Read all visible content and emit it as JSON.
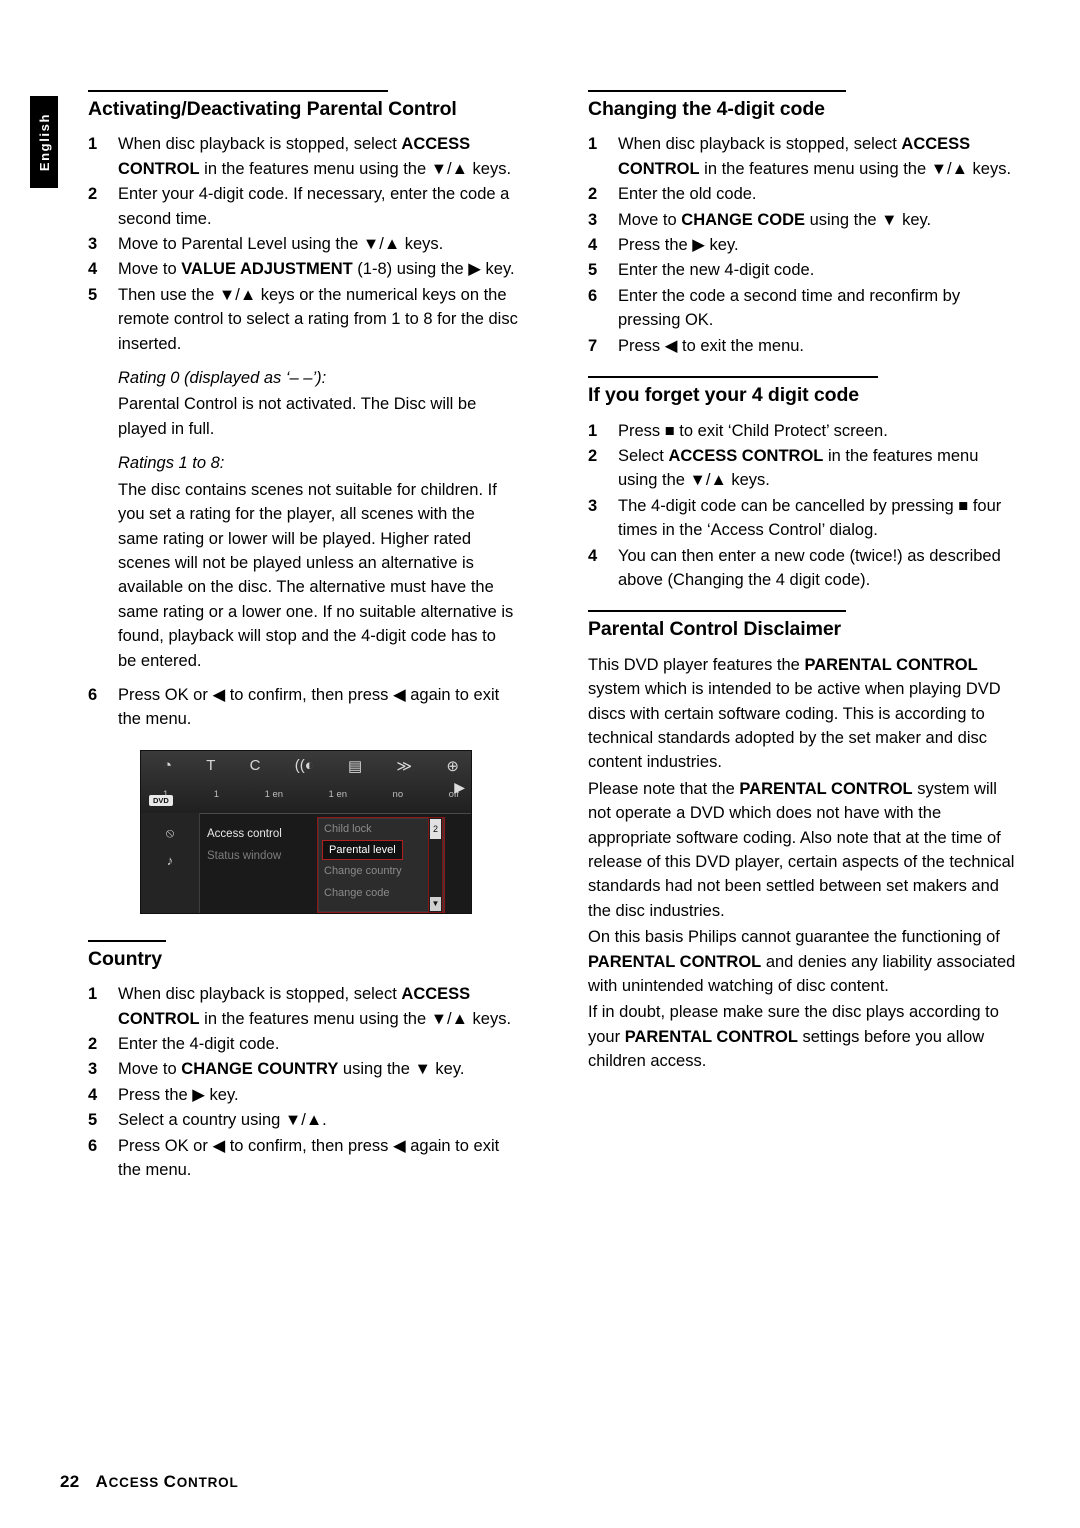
{
  "page": {
    "language_tab": "English",
    "footer_page": "22",
    "footer_title_a": "A",
    "footer_title_b": "CCESS ",
    "footer_title_c": "C",
    "footer_title_d": "ONTROL"
  },
  "left": {
    "s1": {
      "heading": "Activating/Deactivating Parental Control",
      "steps": [
        {
          "n": "1",
          "html": "When disc playback is stopped, select <b>ACCESS CONTROL</b> in the features menu using the ▼/▲ keys."
        },
        {
          "n": "2",
          "html": "Enter your 4-digit code. If necessary, enter the code a second time."
        },
        {
          "n": "3",
          "html": "Move to Parental Level using the ▼/▲ keys."
        },
        {
          "n": "4",
          "html": "Move to <b>VALUE ADJUSTMENT</b> (1-8) using the ▶ key."
        },
        {
          "n": "5",
          "html": "Then use the ▼/▲ keys or the numerical keys on the remote control to select a rating from 1 to 8 for the disc inserted."
        }
      ],
      "italic_1": "Rating 0 (displayed as ‘– –’):",
      "para_1": "Parental Control is not activated. The Disc will be played in full.",
      "italic_2": "Ratings 1 to 8:",
      "para_2": "The disc contains scenes not suitable for children. If you set a rating for the player, all scenes with the same rating or lower will be played. Higher rated scenes will not be played unless an alternative is available on the disc. The alternative must have the same rating or a lower one. If no suitable alternative is found, playback will stop and the 4-digit code has to be entered.",
      "step_6": {
        "n": "6",
        "html": "Press OK or ◀ to confirm, then press ◀ again to exit the menu."
      }
    },
    "osd": {
      "icons": [
        "◔",
        "T",
        "C",
        "((◐",
        "▤",
        "≫",
        "⊕"
      ],
      "values": [
        "1",
        "1",
        "1 en",
        "1 en",
        "no",
        "off"
      ],
      "dvd_tag": "DVD",
      "menu_items": [
        "Access control",
        "Status window"
      ],
      "panel_rows": [
        "Child lock",
        "Parental level",
        "Change country",
        "Change code"
      ],
      "panel_selected": "Parental level",
      "scroll_value": "2",
      "scroll_down": "▼",
      "side_icons": [
        "⦸",
        "♪"
      ],
      "right_arrow": "▶"
    },
    "s2": {
      "heading": "Country",
      "steps": [
        {
          "n": "1",
          "html": "When disc playback is stopped, select <b>ACCESS CONTROL</b> in the features menu using the ▼/▲ keys."
        },
        {
          "n": "2",
          "html": "Enter the 4-digit code."
        },
        {
          "n": "3",
          "html": "Move to <b>CHANGE COUNTRY</b> using the ▼ key."
        },
        {
          "n": "4",
          "html": "Press the ▶ key."
        },
        {
          "n": "5",
          "html": "Select a country using ▼/▲."
        },
        {
          "n": "6",
          "html": "Press OK or ◀ to confirm, then press ◀ again to exit the menu."
        }
      ]
    }
  },
  "right": {
    "s1": {
      "heading": "Changing the 4-digit code",
      "steps": [
        {
          "n": "1",
          "html": "When disc playback is stopped, select <b>ACCESS CONTROL</b> in the features menu using the ▼/▲ keys."
        },
        {
          "n": "2",
          "html": "Enter the old code."
        },
        {
          "n": "3",
          "html": "Move to <b>CHANGE CODE</b> using the ▼ key."
        },
        {
          "n": "4",
          "html": "Press the ▶ key."
        },
        {
          "n": "5",
          "html": "Enter the new 4-digit code."
        },
        {
          "n": "6",
          "html": "Enter the code a second time and reconfirm by pressing OK."
        },
        {
          "n": "7",
          "html": "Press ◀ to exit the menu."
        }
      ]
    },
    "s2": {
      "heading": "If you forget your 4 digit code",
      "steps": [
        {
          "n": "1",
          "html": "Press ■ to exit ‘Child Protect’ screen."
        },
        {
          "n": "2",
          "html": "Select <b>ACCESS CONTROL</b> in the features menu using the ▼/▲ keys."
        },
        {
          "n": "3",
          "html": "The 4-digit code can be cancelled by pressing ■ four times in the ‘Access Control’ dialog."
        },
        {
          "n": "4",
          "html": "You can then enter a new code (twice!) as described above (Changing the 4 digit code)."
        }
      ]
    },
    "s3": {
      "heading": "Parental Control Disclaimer",
      "paragraphs": [
        "This DVD player features the <b>PARENTAL CONTROL</b> system which is intended to be active when playing DVD discs with certain software coding. This is according to technical standards adopted by the set maker and disc content industries.",
        "Please note that the <b>PARENTAL CONTROL</b> system will not operate a DVD which does not have with the appropriate software coding. Also note that at the time of release of this DVD player, certain aspects of the technical standards had not been settled between set makers and the disc industries.",
        "On this basis Philips cannot guarantee the functioning of <b>PARENTAL CONTROL</b> and denies any liability associated with unintended watching of disc content.",
        "If in doubt, please make sure the disc plays according to your <b>PARENTAL CONTROL</b> settings before you allow children access."
      ]
    }
  }
}
